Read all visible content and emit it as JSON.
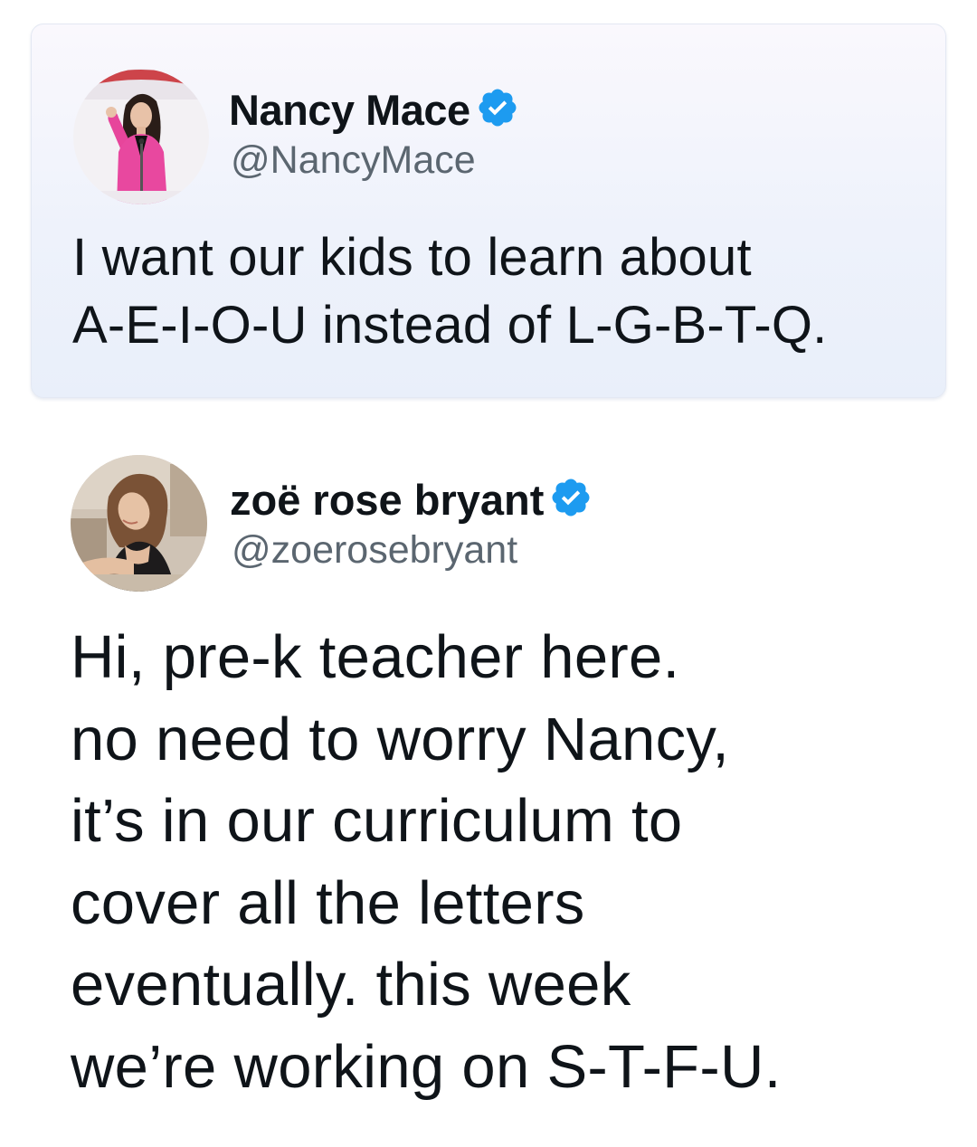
{
  "quoted_tweet": {
    "display_name": "Nancy Mace",
    "handle": "@NancyMace",
    "verified": true,
    "avatar_icon": "profile-photo-woman-pink-jacket",
    "text_lines": [
      "I want our kids to learn about",
      "A-E-I-O-U instead of L-G-B-T-Q."
    ]
  },
  "reply_tweet": {
    "display_name": "zoë rose bryant",
    "handle": "@zoerosebryant",
    "verified": true,
    "avatar_icon": "profile-photo-woman-black-top",
    "text_lines": [
      "Hi, pre-k teacher here.",
      "no need to worry Nancy,",
      "it’s in our curriculum to",
      "cover all the letters",
      "eventually. this week",
      "we’re working on S-T-F-U."
    ]
  },
  "colors": {
    "verified_blue": "#1d9bf0",
    "handle_gray": "#5b6670",
    "text": "#0f1419",
    "card_background": "#eef2fb"
  }
}
